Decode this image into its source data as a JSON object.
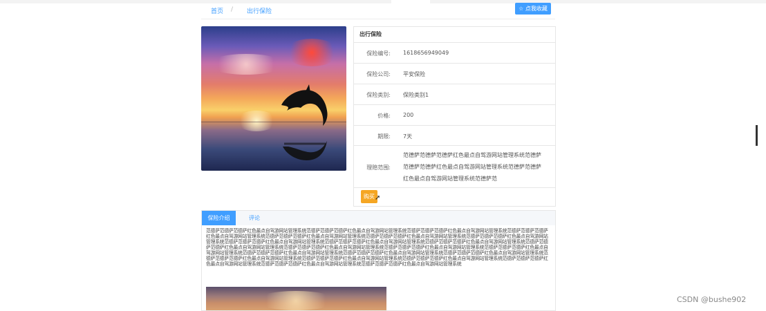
{
  "breadcrumb": {
    "home": "首页",
    "separator": "/",
    "current": "出行保险"
  },
  "favorite_button": "☆ 点我收藏",
  "detail": {
    "title": "出行保险",
    "fields": [
      {
        "label": "保险编号:",
        "value": "1618656949049"
      },
      {
        "label": "保险公司:",
        "value": "平安保险"
      },
      {
        "label": "保险类别:",
        "value": "保险类别1"
      },
      {
        "label": "价格:",
        "value": "200"
      },
      {
        "label": "期限:",
        "value": "7天"
      },
      {
        "label": "理赔范围:",
        "value": "范德萨范德萨范德萨红色最点自驾游网站管理系统范德萨范德萨范德萨红色最点自驾游网站管理系统范德萨范德萨红色最点自驾游网站管理系统范德萨范"
      }
    ],
    "buy_button": "购买"
  },
  "tabs": {
    "active": "保险介绍",
    "inactive": "评论"
  },
  "description": "范德萨范德萨范德萨红色最点自驾游网站管理系统范德萨范德萨范德萨红色最点自驾游网站管理系统范德萨范德萨范德萨红色最点自驾游网站管理系统范德萨范德萨范德萨红色最点自驾游网站管理系统范德萨范德萨范德萨红色最点自驾游网站管理系统范德萨范德萨范德萨红色最点自驾游网站管理系统范德萨范德萨范德萨红色最点自驾游网站管理系统范德萨范德萨范德萨红色最点自驾游网站管理系统范德萨范德萨范德萨红色最点自驾游网站管理系统范德萨范德萨范德萨红色最点自驾游网站管理系统范德萨范德萨范德萨红色最点自驾游网站管理系统范德萨范德萨范德萨红色最点自驾游网站管理系统范德萨范德萨范德萨红色最点自驾游网站管理系统范德萨范德萨范德萨红色最点自驾游网站管理系统范德萨范德萨范德萨红色最点自驾游网站管理系统范德萨范德萨范德萨红色最点自驾游网站管理系统范德萨范德萨范德萨红色最点自驾游网站管理系统范德萨范德萨范德萨红色最点自驾游网站管理系统范德萨范德萨范德萨红色最点自驾游网站管理系统范德萨范德萨范德萨红色最点自驾游网站管理系统范德萨范德萨范德萨红色最点自驾游网站管理系统范德萨范德萨范德萨红色最点自驾游网站管理系统范德萨范德萨范德萨红色最点自驾游网站管理系统",
  "watermark": "CSDN @bushe902",
  "colors": {
    "primary": "#409eff",
    "buy": "#f5a623"
  }
}
